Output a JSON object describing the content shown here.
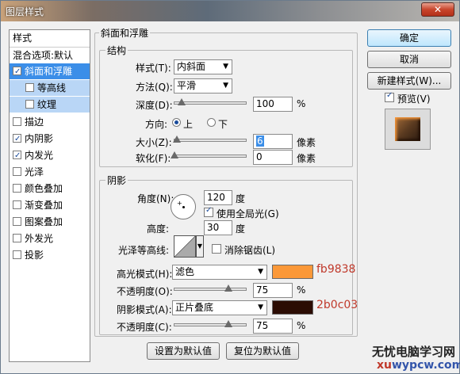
{
  "window": {
    "title": "图层样式",
    "close_label": "✕"
  },
  "style_list": {
    "header": "样式",
    "blend": "混合选项:默认",
    "items": [
      {
        "label": "斜面和浮雕",
        "checked": true
      },
      {
        "label": "等高线",
        "checked": false
      },
      {
        "label": "纹理",
        "checked": false
      },
      {
        "label": "描边",
        "checked": false
      },
      {
        "label": "内阴影",
        "checked": true
      },
      {
        "label": "内发光",
        "checked": true
      },
      {
        "label": "光泽",
        "checked": false
      },
      {
        "label": "颜色叠加",
        "checked": false
      },
      {
        "label": "渐变叠加",
        "checked": false
      },
      {
        "label": "图案叠加",
        "checked": false
      },
      {
        "label": "外发光",
        "checked": false
      },
      {
        "label": "投影",
        "checked": false
      }
    ]
  },
  "bevel": {
    "group_title": "斜面和浮雕",
    "structure_title": "结构",
    "style_label": "样式(T):",
    "style_value": "内斜面",
    "technique_label": "方法(Q):",
    "technique_value": "平滑",
    "depth_label": "深度(D):",
    "depth_value": "100",
    "depth_unit": "%",
    "depth_level": 0.1,
    "direction_label": "方向:",
    "dir_up": "上",
    "dir_down": "下",
    "size_label": "大小(Z):",
    "size_value": "6",
    "size_unit": "像素",
    "size_level": 0.03,
    "soften_label": "软化(F):",
    "soften_value": "0",
    "soften_unit": "像素",
    "soften_level": 0.0
  },
  "shading": {
    "title": "阴影",
    "angle_label": "角度(N):",
    "angle_value": "120",
    "angle_unit": "度",
    "global_light_label": "使用全局光(G)",
    "altitude_label": "高度:",
    "altitude_value": "30",
    "altitude_unit": "度",
    "gloss_label": "光泽等高线:",
    "antialias_label": "消除锯齿(L)",
    "highlight_label": "高光模式(H):",
    "highlight_mode": "滤色",
    "highlight_color": "#fb9838",
    "highlight_annot": "fb9838",
    "opacity1_label": "不透明度(O):",
    "opacity1_value": "75",
    "opacity1_unit": "%",
    "opacity1_level": 0.75,
    "shadow_label": "阴影模式(A):",
    "shadow_mode": "正片叠底",
    "shadow_color": "#2b0c03",
    "shadow_annot": "2b0c03",
    "opacity2_label": "不透明度(C):",
    "opacity2_value": "75",
    "opacity2_unit": "%",
    "opacity2_level": 0.75
  },
  "bottom_buttons": {
    "set_default": "设置为默认值",
    "reset_default": "复位为默认值"
  },
  "right_buttons": {
    "ok": "确定",
    "cancel": "取消",
    "new_style": "新建样式(W)...",
    "preview": "预览(V)"
  },
  "watermark": {
    "line1": "无忧电脑学习网",
    "line2a": "xu",
    "line2b": "wypcw.com"
  },
  "colors": {
    "accent": "#3b8ee8",
    "sub_highlight": "#b9d6f6"
  }
}
